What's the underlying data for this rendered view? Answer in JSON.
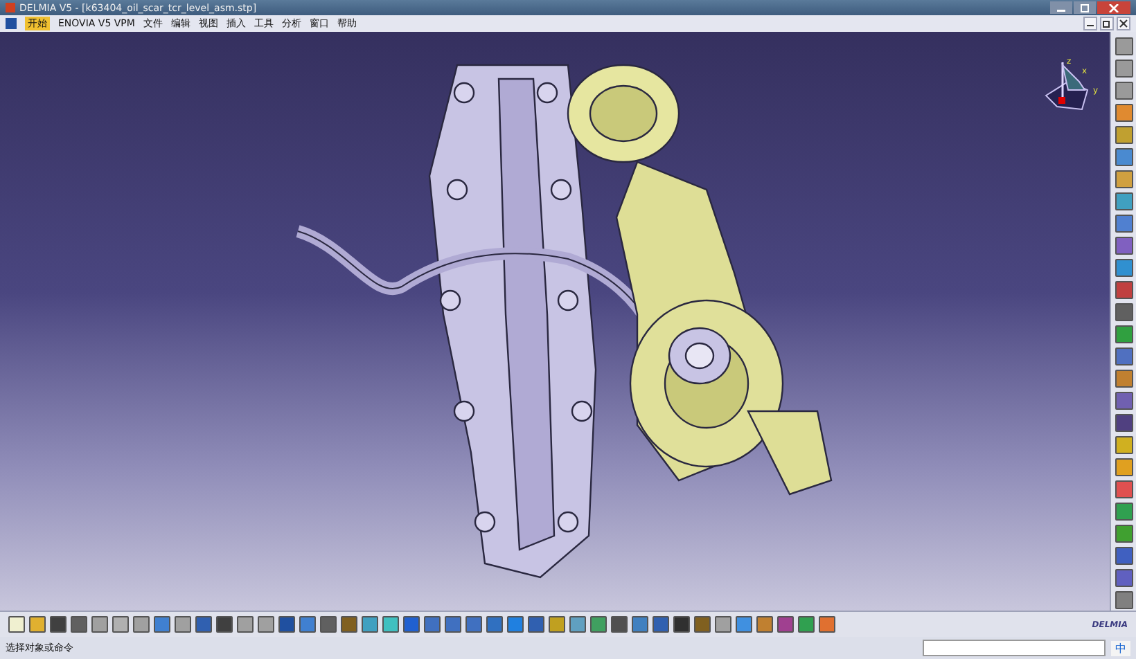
{
  "window": {
    "title": "DELMIA V5 - [k63404_oil_scar_tcr_level_asm.stp]"
  },
  "menu": [
    {
      "label": "开始",
      "kind": "start"
    },
    {
      "label": "ENOVIA V5 VPM",
      "kind": "item"
    },
    {
      "label": "文件",
      "kind": "item"
    },
    {
      "label": "编辑",
      "kind": "item"
    },
    {
      "label": "视图",
      "kind": "item"
    },
    {
      "label": "插入",
      "kind": "item"
    },
    {
      "label": "工具",
      "kind": "item"
    },
    {
      "label": "分析",
      "kind": "item"
    },
    {
      "label": "窗口",
      "kind": "item"
    },
    {
      "label": "帮助",
      "kind": "item"
    }
  ],
  "compass": {
    "axes": [
      "z",
      "x",
      "y"
    ]
  },
  "brand": {
    "label": "DELMIA"
  },
  "status_bar": {
    "text": "选择对象或命令",
    "ime": "中"
  }
}
